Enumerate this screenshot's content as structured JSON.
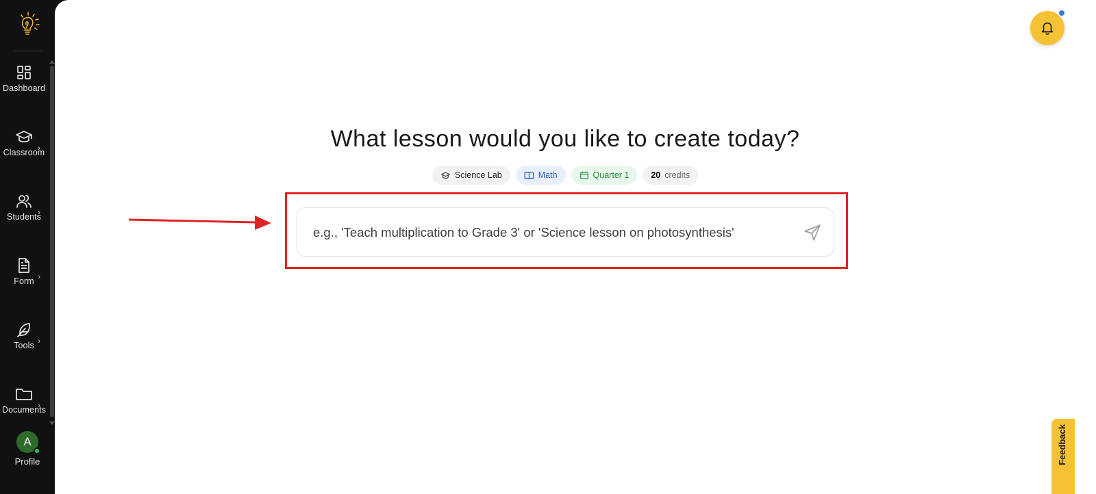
{
  "sidebar": {
    "items": [
      {
        "label": "Dashboard",
        "icon": "dashboard-icon"
      },
      {
        "label": "Classroom",
        "icon": "graduation-cap-icon"
      },
      {
        "label": "Students",
        "icon": "users-icon"
      },
      {
        "label": "Form",
        "icon": "document-icon"
      },
      {
        "label": "Tools",
        "icon": "feather-icon"
      },
      {
        "label": "Documents",
        "icon": "folder-icon"
      }
    ],
    "profile": {
      "initial": "A",
      "label": "Profile"
    }
  },
  "main": {
    "headline": "What lesson would you like to create today?",
    "chips": [
      {
        "label": "Science Lab",
        "icon": "graduation-cap-icon"
      },
      {
        "label": "Math",
        "icon": "book-icon"
      },
      {
        "label": "Quarter 1",
        "icon": "calendar-icon"
      }
    ],
    "credits": {
      "count": "20",
      "label": "credits"
    },
    "prompt": {
      "placeholder": "e.g., 'Teach multiplication to Grade 3' or 'Science lesson on photosynthesis'",
      "value": ""
    },
    "feedback_label": "Feedback"
  },
  "colors": {
    "sidebar_bg": "#111111",
    "accent_yellow": "#f5c235",
    "highlight_red": "#e02424",
    "chip_blue_text": "#2a59c9",
    "chip_green_text": "#258a3b"
  }
}
